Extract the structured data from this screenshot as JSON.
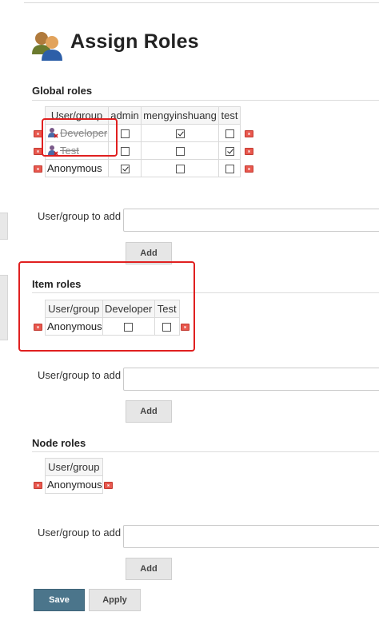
{
  "page": {
    "title": "Assign Roles"
  },
  "global_roles": {
    "title": "Global roles",
    "headers": [
      "User/group",
      "admin",
      "mengyinshuang",
      "test"
    ],
    "rows": [
      {
        "name": "Developer",
        "strikethrough": true,
        "checks": [
          false,
          true,
          false
        ]
      },
      {
        "name": "Test",
        "strikethrough": true,
        "checks": [
          false,
          false,
          true
        ]
      },
      {
        "name": "Anonymous",
        "strikethrough": false,
        "checks": [
          true,
          false,
          false
        ]
      }
    ],
    "add_label": "User/group to add",
    "add_value": "",
    "add_button": "Add"
  },
  "item_roles": {
    "title": "Item roles",
    "headers": [
      "User/group",
      "Developer",
      "Test"
    ],
    "rows": [
      {
        "name": "Anonymous",
        "checks": [
          false,
          false
        ]
      }
    ],
    "add_label": "User/group to add",
    "add_value": "",
    "add_button": "Add"
  },
  "node_roles": {
    "title": "Node roles",
    "headers": [
      "User/group"
    ],
    "rows": [
      {
        "name": "Anonymous"
      }
    ],
    "add_label": "User/group to add",
    "add_value": "",
    "add_button": "Add"
  },
  "actions": {
    "save": "Save",
    "apply": "Apply"
  },
  "colors": {
    "annotation": "#e02020",
    "save_button": "#4b758b",
    "delete_icon": "#e8584e"
  }
}
